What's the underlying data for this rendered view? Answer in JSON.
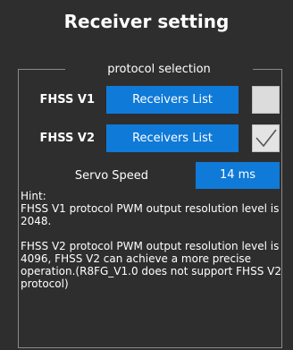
{
  "title": "Receiver setting",
  "protocol_group": {
    "legend": "protocol selection",
    "fhss_v1": {
      "label": "FHSS V1",
      "button_label": "Receivers List",
      "checked": false
    },
    "fhss_v2": {
      "label": "FHSS V2",
      "button_label": "Receivers List",
      "checked": true
    },
    "servo_speed": {
      "label": "Servo Speed",
      "value": "14 ms"
    },
    "hint": {
      "heading": "Hint:",
      "paragraph_1": "FHSS V1 protocol PWM output resolution level is 2048.",
      "paragraph_2": "FHSS V2 protocol PWM output resolution level is 4096, FHSS V2 can achieve a more precise operation.(R8FG_V1.0 does not support FHSS V2 protocol)"
    }
  },
  "colors": {
    "background": "#2e2e2e",
    "accent_blue": "#0f7ad8",
    "checkbox_fill": "#dcdcdc"
  }
}
